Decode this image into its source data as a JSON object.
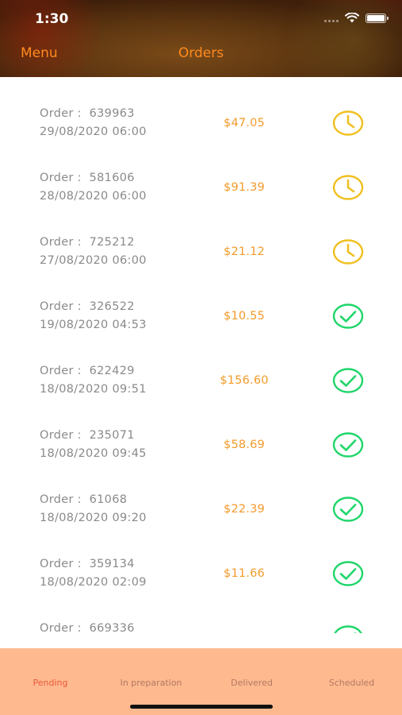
{
  "status_bar": {
    "time": "1:30"
  },
  "nav": {
    "menu_label": "Menu",
    "title": "Orders"
  },
  "colors": {
    "accent": "#ff8a1e",
    "pending_icon": "#f0c020",
    "done_icon": "#1fd66a",
    "tabbar_bg": "#ffb98f"
  },
  "orders": [
    {
      "order_label": "Order :  639963",
      "date": "29/08/2020 06:00",
      "price": "$47.05",
      "status_icon": "clock-icon"
    },
    {
      "order_label": "Order :  581606",
      "date": "28/08/2020 06:00",
      "price": "$91.39",
      "status_icon": "clock-icon"
    },
    {
      "order_label": "Order :  725212",
      "date": "27/08/2020 06:00",
      "price": "$21.12",
      "status_icon": "clock-icon"
    },
    {
      "order_label": "Order :  326522",
      "date": "19/08/2020 04:53",
      "price": "$10.55",
      "status_icon": "check-circle-icon"
    },
    {
      "order_label": "Order :  622429",
      "date": "18/08/2020 09:51",
      "price": "$156.60",
      "status_icon": "check-circle-icon"
    },
    {
      "order_label": "Order :  235071",
      "date": "18/08/2020 09:45",
      "price": "$58.69",
      "status_icon": "check-circle-icon"
    },
    {
      "order_label": "Order :  61068",
      "date": "18/08/2020 09:20",
      "price": "$22.39",
      "status_icon": "check-circle-icon"
    },
    {
      "order_label": "Order :  359134",
      "date": "18/08/2020 02:09",
      "price": "$11.66",
      "status_icon": "check-circle-icon"
    },
    {
      "order_label": "Order :  669336",
      "date": "",
      "price": "",
      "status_icon": "check-circle-icon"
    }
  ],
  "tabs": [
    {
      "label": "Pending",
      "active": true
    },
    {
      "label": "In preparation",
      "active": false
    },
    {
      "label": "Delivered",
      "active": false
    },
    {
      "label": "Scheduled",
      "active": false
    }
  ]
}
